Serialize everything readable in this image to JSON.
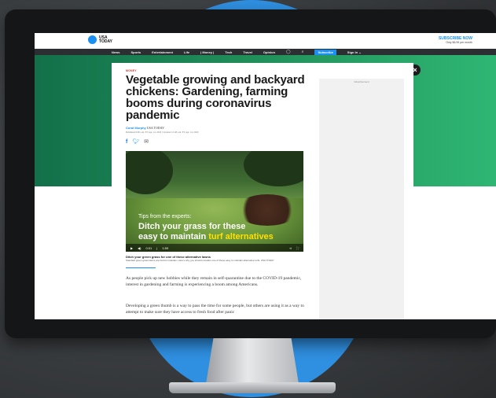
{
  "colors": {
    "accent": "#1b8ff2",
    "green_band": "#22915b",
    "highlight_yellow": "#ffe000",
    "brand_blue": "#2f8fe0"
  },
  "header": {
    "logo_text": "USA TODAY",
    "subscribe_now": "SUBSCRIBE NOW",
    "subscribe_sub": "Only $6.99 per month"
  },
  "nav": {
    "items": [
      "News",
      "Sports",
      "Entertainment",
      "Life",
      "| Money |",
      "Tech",
      "Travel",
      "Opinion"
    ],
    "subscribe": "Subscribe",
    "sign_in": "Sign In ⌄",
    "icons": [
      "weather-icon",
      "search-icon"
    ]
  },
  "ad": {
    "label": "Advertisement"
  },
  "article": {
    "section": "MONEY",
    "headline": "Vegetable growing and backyard chickens: Gardening, farming booms during coronavirus pandemic",
    "author": "Coral Murphy",
    "outlet": "USA TODAY",
    "dateline": "Published 6:00 a.m. ET Apr. 14, 2020 | Updated 11:48 a.m. ET Apr. 14, 2020",
    "share_icons": [
      "facebook-icon",
      "twitter-icon",
      "email-icon"
    ],
    "video": {
      "caption_small": "Tips from the experts:",
      "caption_line1": "Ditch your grass for these",
      "caption_line2_plain": "easy to maintain",
      "caption_line2_highlight": "turf alternatives",
      "time_current": "0:01",
      "time_total": "1:59",
      "title": "Ditch your green grass for one of these alternative lawns",
      "description": "Standard green grass lawns are hard to maintain. Here's why you should consider one of these easy to maintain alternative turfs. USA TODAY"
    },
    "paragraphs": [
      "As people pick up new hobbies while they remain in self-quarantine due to the COVID-19 pandemic, interest in gardening and farming is experiencing a boom among Americans.",
      "Developing a green thumb is a way to pass the time for some people, but others are using it as a way to attempt to make sure they have access to fresh food after panic"
    ]
  }
}
